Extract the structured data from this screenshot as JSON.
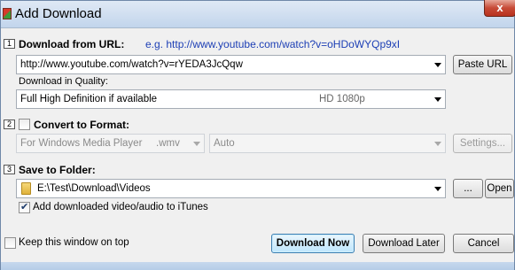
{
  "window": {
    "title": "Add Download",
    "close_glyph": "x"
  },
  "sections": {
    "download_url": {
      "number": "1",
      "label": "Download from URL:",
      "hint": "e.g. http://www.youtube.com/watch?v=oHDoWYQp9xI",
      "url_value": "http://www.youtube.com/watch?v=rYEDA3JcQqw",
      "paste_button": "Paste URL",
      "quality_label": "Download in Quality:",
      "quality_value": "Full High Definition if available",
      "quality_tag": "HD 1080p"
    },
    "convert": {
      "number": "2",
      "label": "Convert to Format:",
      "checked": false,
      "format_value": "For Windows Media Player",
      "format_ext": ".wmv",
      "preset_value": "Auto",
      "settings_button": "Settings..."
    },
    "save": {
      "number": "3",
      "label": "Save to Folder:",
      "folder_value": "E:\\Test\\Download\\Videos",
      "browse_button": "...",
      "open_button": "Open",
      "itunes_label": "Add downloaded video/audio to iTunes",
      "itunes_checked": true
    }
  },
  "footer": {
    "keep_open_label": "Keep this window on top",
    "keep_open_checked": false,
    "download_now": "Download Now",
    "download_later": "Download Later",
    "cancel": "Cancel"
  },
  "colors": {
    "hint": "#1d3fb5",
    "title_bar": "#c2d5ec",
    "close_button": "#c74a36"
  }
}
